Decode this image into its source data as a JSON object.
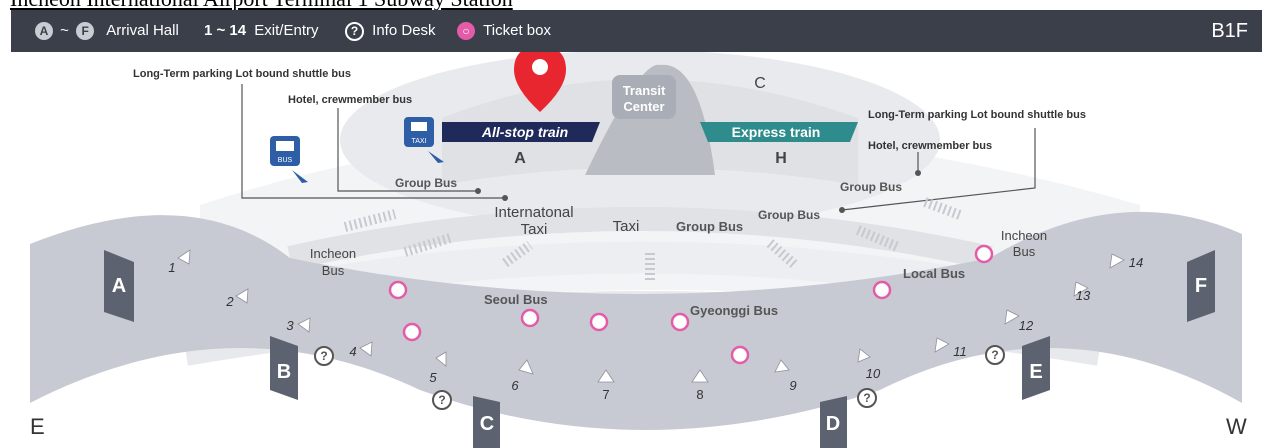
{
  "title": "Incheon International Airport Terminal 1 Subway Station",
  "legend": {
    "arrival_a": "A",
    "arrival_tilde": "~",
    "arrival_f": "F",
    "arrival_label": "Arrival Hall",
    "exits_range": "1 ~ 14",
    "exits_label": "Exit/Entry",
    "info_label": "Info Desk",
    "ticket_label": "Ticket box",
    "floor": "B1F"
  },
  "map": {
    "station_zone_c": "C",
    "transit_line1": "Transit",
    "transit_line2": "Center",
    "all_stop_train": "All-stop train",
    "express_train": "Express train",
    "zone_a": "A",
    "zone_h": "H",
    "left_longterm": "Long-Term parking Lot bound shuttle bus",
    "left_hotel": "Hotel, crewmember bus",
    "right_longterm": "Long-Term parking Lot bound shuttle bus",
    "right_hotel": "Hotel, crewmember bus",
    "group_bus_left": "Group Bus",
    "group_bus_right_top": "Group Bus",
    "group_bus_right": "Group Bus",
    "group_bus_center": "Group Bus",
    "intl_taxi_line1": "Internatonal",
    "intl_taxi_line2": "Taxi",
    "taxi": "Taxi",
    "incheon_bus_left_line1": "Incheon",
    "incheon_bus_left_line2": "Bus",
    "incheon_bus_right_line1": "Incheon",
    "incheon_bus_right_line2": "Bus",
    "seoul_bus": "Seoul Bus",
    "gyeonggi_bus": "Gyeonggi Bus",
    "local_bus": "Local Bus",
    "direction_e": "E",
    "direction_w": "W",
    "bus_icon_text": "BUS",
    "taxi_icon_text": "TAXI"
  },
  "halls": [
    "A",
    "B",
    "C",
    "D",
    "E",
    "F"
  ],
  "exits": [
    "1",
    "2",
    "3",
    "4",
    "5",
    "6",
    "7",
    "8",
    "9",
    "10",
    "11",
    "12",
    "13",
    "14"
  ]
}
